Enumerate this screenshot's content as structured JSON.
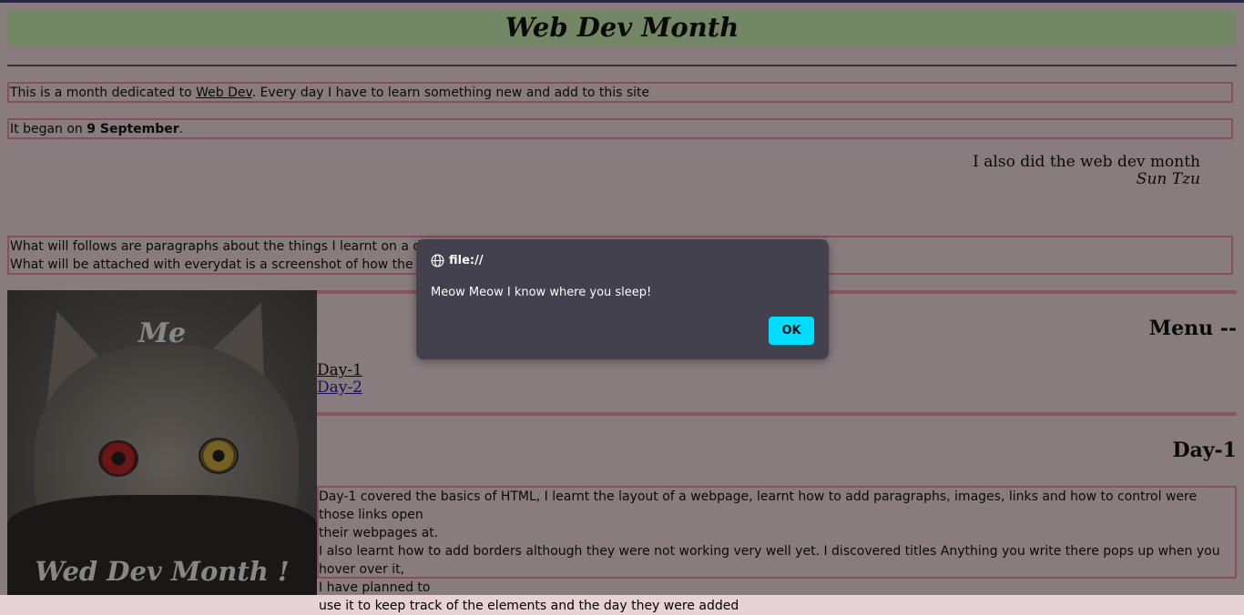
{
  "page": {
    "title": "Web Dev Month",
    "intro_prefix": "This is a month dedicated to ",
    "intro_link": "Web Dev",
    "intro_suffix": ". Every day I have to learn something new and add to this site",
    "began_prefix": "It began on ",
    "began_date": "9 September",
    "began_suffix": ".",
    "quote_text": "I also did the web dev month",
    "quote_author": "Sun Tzu",
    "follow_line1": "What will follows are paragraphs about the things I learnt on a day and",
    "follow_line2": "What will be attached with everydat is a screenshot of how the site looks"
  },
  "image": {
    "top_text": "Me",
    "bottom_text": "Wed Dev Month !"
  },
  "menu": {
    "title": "Menu --",
    "items": [
      {
        "label": "Day-1"
      },
      {
        "label": "Day-2"
      }
    ]
  },
  "day1": {
    "title": "Day-1",
    "line1": "Day-1 covered the basics of HTML, I learnt the layout of a webpage, learnt how to add paragraphs, images, links and how to control were those links open",
    "line2": "their webpages at.",
    "line3": "I also learnt how to add borders although they were not working very well yet. I discovered titles Anything you write there pops up when you hover over it,",
    "line4": "I have planned to",
    "line5": "use it to keep track of the elements and the day they were added"
  },
  "dialog": {
    "origin": "file://",
    "message": "Meow Meow I know where you sleep!",
    "ok_label": "OK",
    "icon": "globe-icon"
  },
  "colors": {
    "page_bg": "#e9d2d6",
    "header_bg": "#c4e6a8",
    "border": "#e6808e",
    "dialog_bg": "#42414d",
    "ok_button": "#00ddff"
  }
}
